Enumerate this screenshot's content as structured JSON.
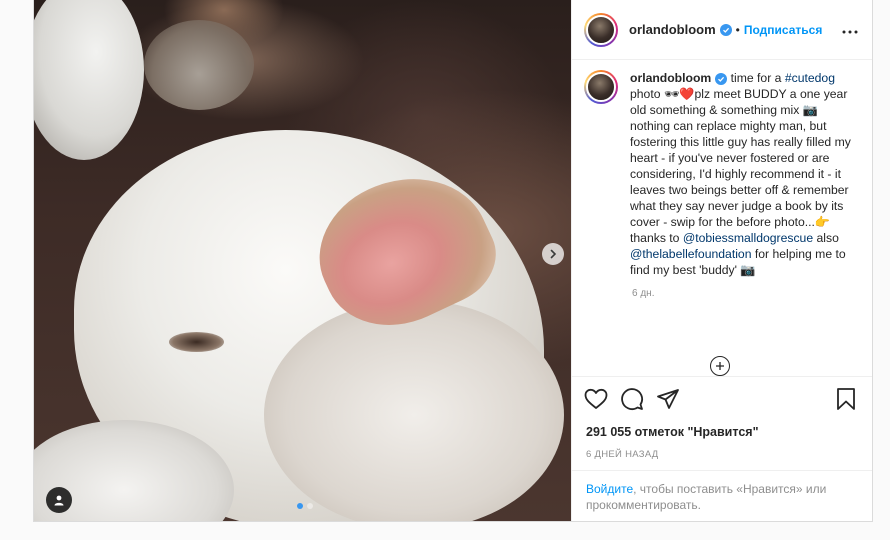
{
  "post": {
    "username": "orlandobloom",
    "separator": "•",
    "follow_label": "Подписаться",
    "more_label": "•••",
    "caption_text_1": " time for a ",
    "hashtag": "#cutedog",
    "caption_text_2": " photo 🕶❤️plz meet BUDDY a one year old something & something mix 📷\nnothing can replace mighty man, but fostering this little guy has really filled my heart - if you've never fostered or are considering, I'd highly recommend it - it leaves two beings better off & remember what they say never judge a book by its cover - swip for the before photo...👉 thanks to ",
    "mention_1": "@tobiessmalldogrescue",
    "caption_text_3": " also ",
    "mention_2": "@thelabellefoundation",
    "caption_text_4": " for helping me to find my best 'buddy' 📷",
    "time_ago": "6 дн.",
    "likes": "291 055 отметок \"Нравится\"",
    "date": "6 ДНЕЙ НАЗАД",
    "login_link": "Войдите",
    "login_text": ", чтобы поставить «Нравится» или прокомментировать."
  },
  "carousel": {
    "slide_count": 2,
    "active_index": 0
  },
  "colors": {
    "accent": "#0095f6",
    "verified": "#3897f0",
    "muted": "#8e8e8e"
  },
  "icons": [
    "next-arrow-icon",
    "user-tag-icon",
    "verified-icon",
    "more-options-icon",
    "load-more-icon",
    "heart-icon",
    "comment-icon",
    "share-icon",
    "bookmark-icon"
  ]
}
